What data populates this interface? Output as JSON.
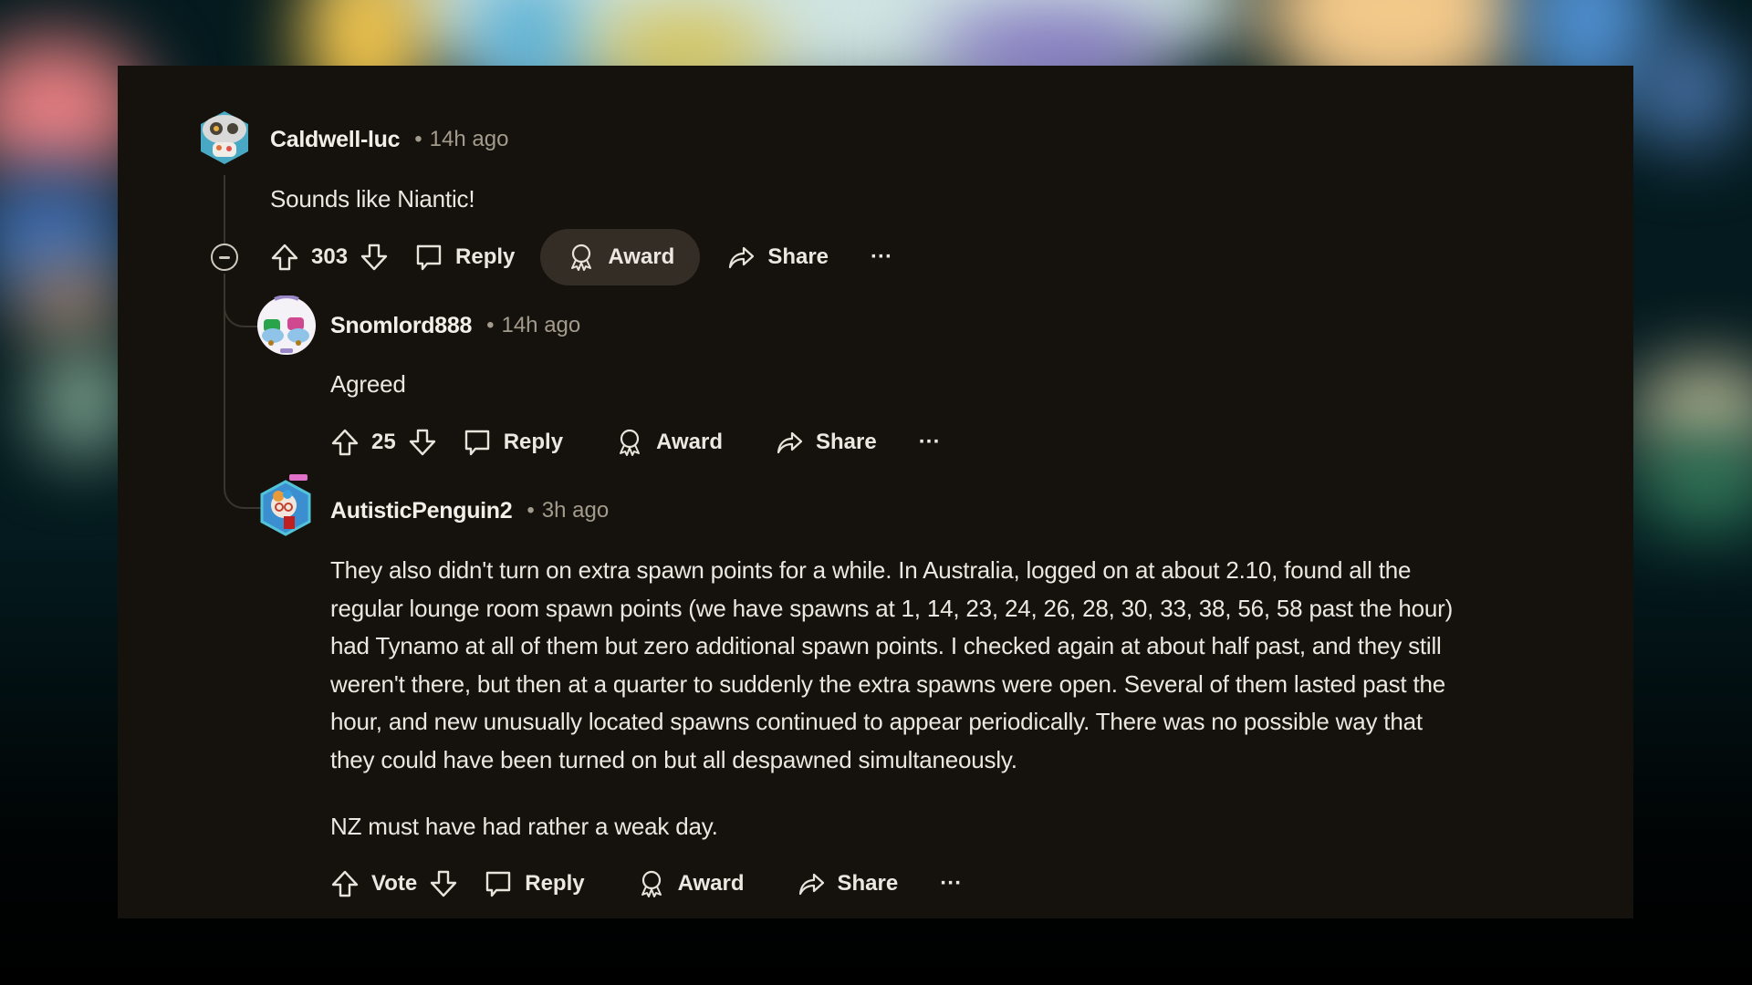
{
  "colors": {
    "panel_bg": "#15110c",
    "text": "#ece8e1",
    "meta": "#a39b8c",
    "pill_hover": "#332d25",
    "thread": "#3a352e"
  },
  "comments": [
    {
      "username": "Caldwell-luc",
      "separator": "•",
      "time": "14h ago",
      "avatar": "hexagon-snoo-avatar",
      "body": [
        "Sounds like Niantic!"
      ],
      "votes": "303",
      "actions": {
        "reply": "Reply",
        "award": "Award",
        "share": "Share",
        "more": "···"
      },
      "award_hovered": true,
      "collapse_icon": "minus-circle-icon"
    },
    {
      "username": "Snomlord888",
      "separator": "•",
      "time": "14h ago",
      "avatar": "round-snoo-avatar",
      "body": [
        "Agreed"
      ],
      "votes": "25",
      "actions": {
        "reply": "Reply",
        "award": "Award",
        "share": "Share",
        "more": "···"
      }
    },
    {
      "username": "AutisticPenguin2",
      "separator": "•",
      "time": "3h ago",
      "avatar": "hexagon-snoo-avatar",
      "body": [
        "They also didn't turn on extra spawn points for a while. In Australia, logged on at about 2.10, found all the",
        "regular lounge room spawn points (we have spawns at 1, 14, 23, 24, 26, 28, 30, 33, 38, 56, 58 past the hour)",
        "had Tynamo at all of them but zero additional spawn points. I checked again at about half past, and they still",
        "weren't there, but then at a quarter to suddenly the extra spawns were open. Several of them lasted past the",
        "hour, and new unusually located spawns continued to appear periodically. There was no possible way that",
        "they could have been turned on but all despawned simultaneously."
      ],
      "body2": "NZ must have had rather a weak day.",
      "votes": "Vote",
      "actions": {
        "reply": "Reply",
        "award": "Award",
        "share": "Share",
        "more": "···"
      }
    }
  ]
}
